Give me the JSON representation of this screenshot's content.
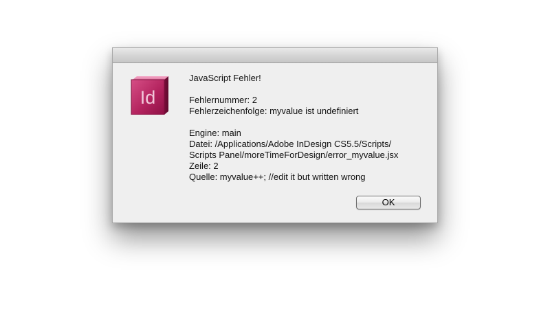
{
  "dialog": {
    "app_icon": "indesign-app-icon",
    "app_icon_text": "Id",
    "colors": {
      "icon_top": "#d64f86",
      "icon_bottom": "#8e1045",
      "icon_text": "#f2c8da"
    },
    "heading": "JavaScript Fehler!",
    "error_number": "Fehlernummer: 2",
    "error_string": "Fehlerzeichenfolge: myvalue ist undefiniert",
    "engine": "Engine: main",
    "file_line1": "Datei: /Applications/Adobe InDesign CS5.5/Scripts/",
    "file_line2": "Scripts Panel/moreTimeForDesign/error_myvalue.jsx",
    "line_number": "Zeile: 2",
    "source": "Quelle: myvalue++; //edit it but written wrong",
    "ok_label": "OK"
  }
}
